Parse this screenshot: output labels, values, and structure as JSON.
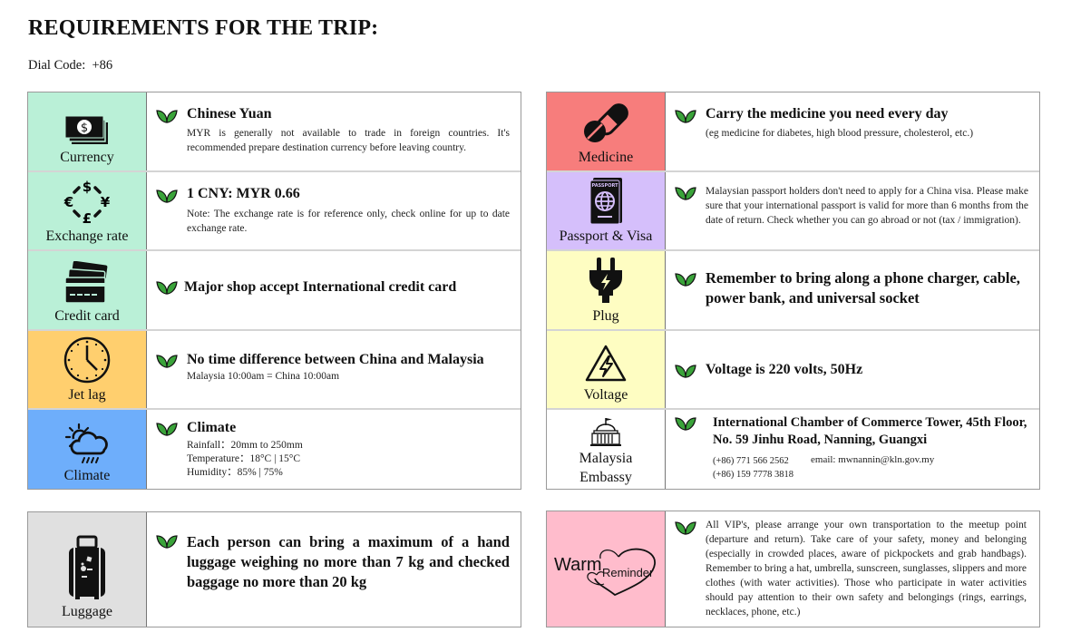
{
  "page": {
    "title": "REQUIREMENTS FOR THE TRIP:",
    "dial_code_label": "Dial Code:",
    "dial_code_value": "+86"
  },
  "colors": {
    "currency_bg": "#baf0d7",
    "jetlag_bg": "#ffcf6e",
    "climate_bg": "#6eaefb",
    "luggage_bg": "#e0e0e0",
    "medicine_bg": "#f77d7c",
    "passport_bg": "#d5bffb",
    "plug_bg": "#fefdc2",
    "reminder_bg": "#ffbccc",
    "leaf": "#3aa33a"
  },
  "left_table": [
    {
      "icon": "money-icon",
      "label": "Currency",
      "heading": "Chinese Yuan",
      "text": "MYR is generally not available to trade in foreign countries. It's recommended prepare destination currency before leaving country."
    },
    {
      "icon": "exchange-icon",
      "label": "Exchange rate",
      "heading": "1 CNY: MYR 0.66",
      "text": "Note: The exchange rate is for reference only, check online for up to date exchange rate."
    },
    {
      "icon": "credit-card-icon",
      "label": "Credit card",
      "heading": "Major shop accept International credit card"
    },
    {
      "icon": "clock-icon",
      "label": "Jet lag",
      "heading": "No time difference between China and Malaysia",
      "text": "Malaysia 10:00am = China 10:00am"
    },
    {
      "icon": "weather-icon",
      "label": "Climate",
      "heading": "Climate",
      "lines": [
        "Rainfall：20mm to 250mm",
        "Temperature：18°C | 15°C",
        "Humidity：85% | 75%"
      ]
    }
  ],
  "luggage": {
    "icon": "luggage-icon",
    "label": "Luggage",
    "text": "Each person can bring a maximum of a hand luggage weighing no more than 7 kg and checked baggage no more than 20 kg"
  },
  "right_table": [
    {
      "icon": "pill-icon",
      "label": "Medicine",
      "heading": "Carry the medicine you need every day",
      "text": "(eg medicine for diabetes, high blood pressure, cholesterol, etc.)"
    },
    {
      "icon": "passport-icon",
      "label": "Passport & Visa",
      "text": "Malaysian passport holders don't need to apply for a China visa. Please make sure that your international passport is valid for more than 6 months from the date of return. Check whether you can go abroad or not (tax / immigration)."
    },
    {
      "icon": "plug-icon",
      "label": "Plug",
      "heading": "Remember to bring along a phone charger, cable, power bank, and universal socket"
    },
    {
      "icon": "voltage-icon",
      "label": "Voltage",
      "heading": "Voltage is 220 volts, 50Hz"
    },
    {
      "icon": "embassy-icon",
      "label": "Malaysia Embassy",
      "heading": "International Chamber of Commerce Tower, 45th Floor, No. 59 Jinhu Road, Nanning, Guangxi",
      "phones": [
        "(+86) 771 566 2562",
        "(+86) 159 7778 3818"
      ],
      "email": "email: mwnannin@kln.gov.my"
    }
  ],
  "reminder": {
    "icon": "heart-icon",
    "label_big": "Warm",
    "label_small": "Reminder",
    "text": "All VIP's, please arrange your own transportation to the meetup point (departure and return). Take care of your safety, money and belonging (especially in crowded places, aware of pickpockets and grab handbags). Remember to bring a hat, umbrella, sunscreen, sunglasses, slippers and more clothes (with water activities). Those who participate in water activities should pay attention to their own safety and belongings (rings, earrings, necklaces, phone, etc.)"
  }
}
